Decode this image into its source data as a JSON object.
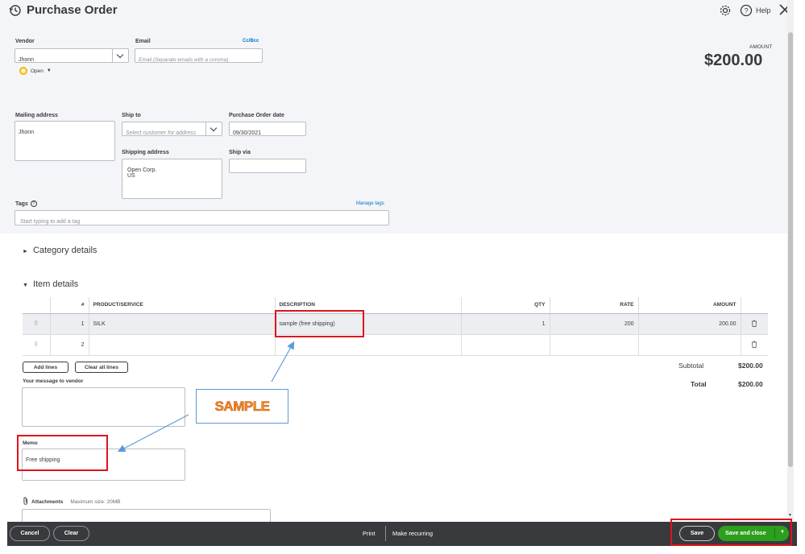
{
  "header": {
    "title": "Purchase Order",
    "help_label": "Help"
  },
  "vendor": {
    "label": "Vendor",
    "value": "Jhonn",
    "status": "Open"
  },
  "email": {
    "label": "Email",
    "placeholder": "Email (Separate emails with a comma)",
    "ccbcc": "Cc/Bcc"
  },
  "amount": {
    "label": "AMOUNT",
    "value": "$200.00"
  },
  "mailing": {
    "label": "Mailing address",
    "value": "Jhonn"
  },
  "ship_to": {
    "label": "Ship to",
    "placeholder": "Select customer for address"
  },
  "po_date": {
    "label": "Purchase Order date",
    "value": "09/30/2021"
  },
  "shipping_address": {
    "label": "Shipping address",
    "value": "Open Corp.\n US"
  },
  "ship_via": {
    "label": "Ship via",
    "value": ""
  },
  "tags": {
    "label": "Tags",
    "manage": "Manage tags",
    "placeholder": "Start typing to add a tag"
  },
  "sections": {
    "category": "Category details",
    "item": "Item details"
  },
  "table": {
    "headers": [
      "#",
      "PRODUCT/SERVICE",
      "DESCRIPTION",
      "QTY",
      "RATE",
      "AMOUNT"
    ],
    "rows": [
      {
        "num": "1",
        "product": "SILK",
        "description": "sample (free shipping)",
        "qty": "1",
        "rate": "200",
        "amount": "200.00"
      },
      {
        "num": "2",
        "product": "",
        "description": "",
        "qty": "",
        "rate": "",
        "amount": ""
      }
    ]
  },
  "buttons": {
    "add_lines": "Add lines",
    "clear_all": "Clear all lines"
  },
  "totals": {
    "subtotal_label": "Subtotal",
    "subtotal": "$200.00",
    "total_label": "Total",
    "total": "$200.00"
  },
  "message": {
    "label": "Your message to vendor",
    "value": ""
  },
  "memo": {
    "label": "Memo",
    "value": "Free shipping"
  },
  "attachments": {
    "label": "Attachments",
    "max": "Maximum size: 20MB"
  },
  "annotation": {
    "text": "SAMPLE"
  },
  "footer": {
    "cancel": "Cancel",
    "clear": "Clear",
    "print": "Print",
    "recurring": "Make recurring",
    "save": "Save",
    "save_close": "Save and close"
  },
  "colors": {
    "accent_green": "#2ca01c",
    "annotation_red": "#e0121c",
    "annotation_orange": "#f28c28",
    "annotation_blue": "#5b9bd5"
  }
}
